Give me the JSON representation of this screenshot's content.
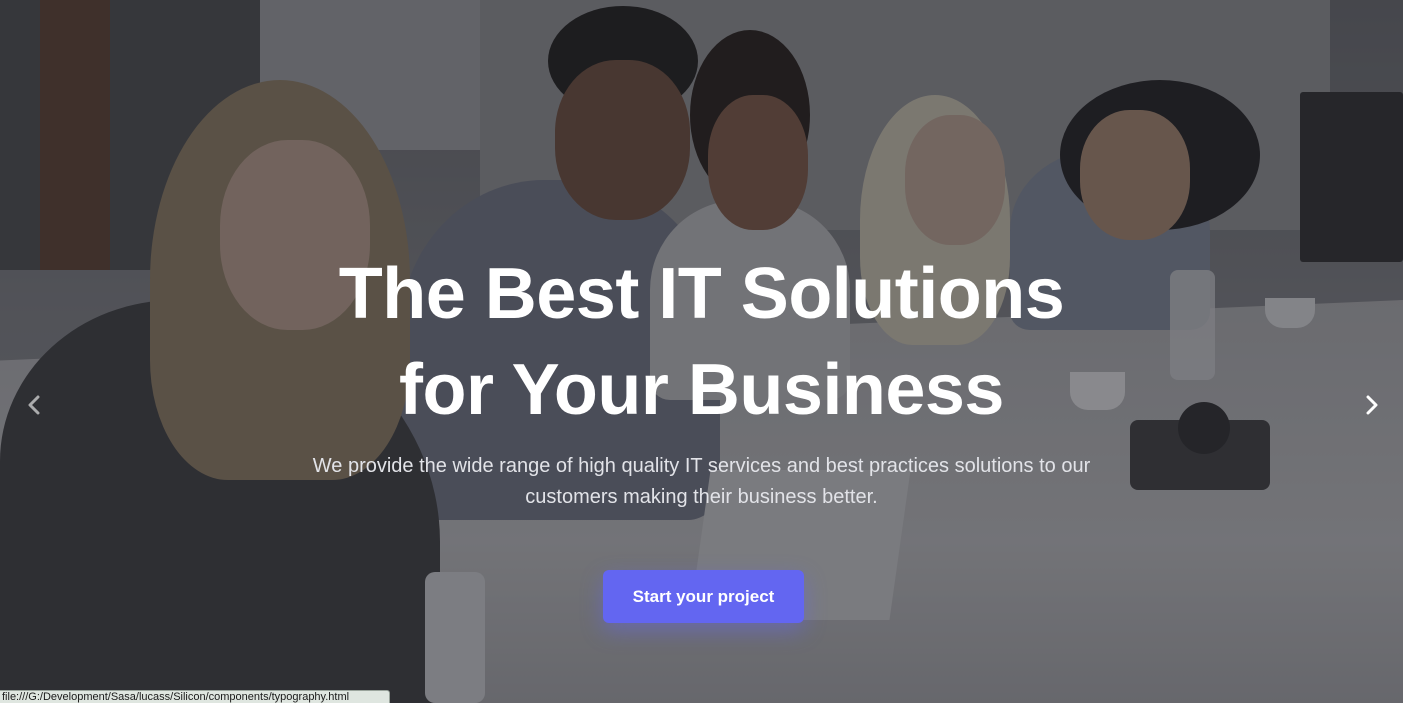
{
  "hero": {
    "headline_line1": "The Best IT Solutions",
    "headline_line2": "for Your Business",
    "lead_line1": "We provide the wide range of high quality IT services and best practices solutions to our",
    "lead_line2": "customers making their business better.",
    "cta_label": "Start your project"
  },
  "carousel": {
    "prev_icon": "chevron-left-icon",
    "next_icon": "chevron-right-icon",
    "prev_glyph": "‹",
    "next_glyph": "›"
  },
  "browser_status": {
    "url": "file:///G:/Development/Sasa/lucass/Silicon/components/typography.html"
  },
  "colors": {
    "accent": "#6366f1",
    "text_primary": "#ffffff",
    "text_secondary": "#e2e3e8"
  }
}
